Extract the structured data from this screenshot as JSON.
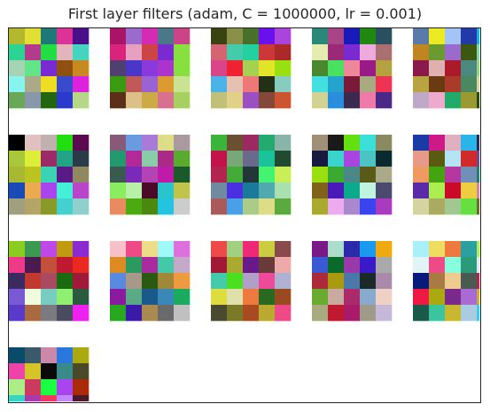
{
  "title": "First layer filters (adam, C = 1000000, lr = 0.001)",
  "chart_data": {
    "type": "heatmap",
    "title": "First layer filters (adam, C = 1000000, lr = 0.001)",
    "grid": {
      "rows": 4,
      "cols": 5,
      "filters": 16
    },
    "filter_size": 5,
    "axes_visible": false,
    "filters": [
      [
        "#b4b82e",
        "#e0e034",
        "#1e7878",
        "#dd3399",
        "#4a108a",
        "#2cd494",
        "#b43a8e",
        "#22dd44",
        "#e2b4bc",
        "#44d4c0",
        "#a4d4b4",
        "#62e488",
        "#7a2ad2",
        "#905010",
        "#c88a20",
        "#88f4f0",
        "#aaaa88",
        "#eedd22",
        "#3a4acc",
        "#dd22dd",
        "#68a858",
        "#8898aa",
        "#226610",
        "#2a3acc",
        "#b4d888"
      ],
      [
        "#aa1466",
        "#9a6acc",
        "#d42ab4",
        "#4a7888",
        "#cc4488",
        "#d8247a",
        "#e8a0c0",
        "#cc4444",
        "#7a2ad0",
        "#88e040",
        "#504070",
        "#4a36c8",
        "#8a3adc",
        "#aa34cc",
        "#88e040",
        "#3a9a10",
        "#c05a58",
        "#9a62d4",
        "#dd9a30",
        "#c8e490",
        "#5c3018",
        "#dcc088",
        "#ccaa44",
        "#d87090",
        "#a8d060"
      ],
      [
        "#3a4410",
        "#8a9048",
        "#48702a",
        "#6a10ee",
        "#aa44dd",
        "#d46472",
        "#44ccaa",
        "#22d0a0",
        "#cc3838",
        "#aa2a2a",
        "#da4488",
        "#ee2233",
        "#a6d050",
        "#e2e42a",
        "#9ae010",
        "#4ab4e8",
        "#e6c0b0",
        "#ee7878",
        "#223018",
        "#88ccc0",
        "#c0c078",
        "#e0d088",
        "#9a50c0",
        "#844838",
        "#cc5430"
      ],
      [
        "#2a8878",
        "#aa4488",
        "#1a1ab8",
        "#1e8810",
        "#2a5060",
        "#e4ecb0",
        "#9a2a78",
        "#7a2ad2",
        "#eeaadd",
        "#aa7070",
        "#4a8830",
        "#4ae060",
        "#ee8899",
        "#9a1a88",
        "#b4a240",
        "#44e0e0",
        "#22a4cc",
        "#7a1a38",
        "#aaaa80",
        "#ee3355",
        "#d2d292",
        "#2a8edc",
        "#3a2a50",
        "#ee7aaa",
        "#4a2888"
      ],
      [
        "#5a7aaa",
        "#ecea22",
        "#a4c4f8",
        "#223aa8",
        "#22aadd",
        "#c08420",
        "#6a9a30",
        "#9a6acc",
        "#3a5810",
        "#88d0aa",
        "#8a1a4a",
        "#e0b0b0",
        "#aa1a2a",
        "#4a8880",
        "#9ad088",
        "#b8a440",
        "#6a3a10",
        "#aa3a2a",
        "#4a8860",
        "#d4d0a8",
        "#c0a8c8",
        "#eeaacc",
        "#22aa6a",
        "#9a9a30",
        "#2a4810"
      ],
      [
        "#000000",
        "#e0c0c0",
        "#c0b0b0",
        "#22dd10",
        "#5c0a50",
        "#a8c83a",
        "#ddee38",
        "#9a2a68",
        "#22a488",
        "#2a3a48",
        "#a8b830",
        "#bcc420",
        "#3ad4b4",
        "#5a1a88",
        "#908860",
        "#1a4ab8",
        "#ecaa50",
        "#aa44ee",
        "#44f0d8",
        "#bb44cc",
        "#a0a080",
        "#b4a468",
        "#8a9a28",
        "#44d0ce",
        "#90d0cc"
      ],
      [
        "#885a78",
        "#6a9ae0",
        "#aa7ad8",
        "#dddd88",
        "#aa9aa0",
        "#229a70",
        "#b22a98",
        "#88ccaa",
        "#aa2a88",
        "#5aaa30",
        "#3a5a50",
        "#7a2ab8",
        "#b444b4",
        "#c01aa8",
        "#1a5a28",
        "#88ee60",
        "#b8f0a8",
        "#4a0a28",
        "#2ac4cc",
        "#c0c44a",
        "#ea8a60",
        "#4aaa10",
        "#4a8810",
        "#22c4e0",
        "#cccccc"
      ],
      [
        "#3ab43a",
        "#6a5030",
        "#9a2a60",
        "#22aa70",
        "#8ab4aa",
        "#c0144a",
        "#78a878",
        "#6a6a8a",
        "#1ac498",
        "#224a30",
        "#b42450",
        "#44aa38",
        "#223838",
        "#44f470",
        "#c8ee58",
        "#708aa0",
        "#4a30e0",
        "#1a7a9a",
        "#50a8b0",
        "#a8e0b0",
        "#aa5a58",
        "#4aa0e8",
        "#aacc88",
        "#dddd88",
        "#5aaa40"
      ],
      [
        "#a09078",
        "#1a1a1a",
        "#64e010",
        "#3ae0d8",
        "#8a8a60",
        "#1a1a40",
        "#3ad4cc",
        "#aa44e0",
        "#4ac4c4",
        "#0a2a30",
        "#9ae010",
        "#3aaa30",
        "#4a8888",
        "#5a5a18",
        "#aaaa88",
        "#80621a",
        "#4a1ab8",
        "#0aaa8a",
        "#c0f4e0",
        "#4a4a70",
        "#aaaa30",
        "#eeaaee",
        "#aa88d0",
        "#3a44ee",
        "#aa3ac0"
      ],
      [
        "#1a3aa8",
        "#cc1a88",
        "#e0b0c0",
        "#2ab4e8",
        "#2a2a50",
        "#e89a88",
        "#5a5a10",
        "#b4e4f4",
        "#d02a2a",
        "#6a4a88",
        "#ee9a60",
        "#44a410",
        "#b438a0",
        "#7090b8",
        "#2a7a70",
        "#5a2aaa",
        "#aaee50",
        "#ca0a28",
        "#eecc44",
        "#c88aa0",
        "#d4d4a0",
        "#aaaa60",
        "#a0c890",
        "#66e040",
        "#6a6a38"
      ],
      [
        "#8acc20",
        "#3a9a50",
        "#c048e8",
        "#c09a10",
        "#8a2ad0",
        "#ee3a88",
        "#4a1a50",
        "#c2503a",
        "#c01a30",
        "#ea2a20",
        "#3a2a60",
        "#c03a30",
        "#aa4a60",
        "#1a6a10",
        "#a01a38",
        "#7a5ad4",
        "#f0fce0",
        "#78ccc0",
        "#90ee70",
        "#2a5a40",
        "#5a3ac8",
        "#aa6a40",
        "#7a7a80",
        "#4a4a60",
        "#ee22ee"
      ],
      [
        "#f8c0c8",
        "#ee4a88",
        "#eedd88",
        "#a0f8f8",
        "#dd70dd",
        "#dd8a20",
        "#2a9a60",
        "#aa2aa0",
        "#44c8a8",
        "#c4a8c8",
        "#5a8ae0",
        "#a89888",
        "#2a5a10",
        "#a08838",
        "#ee9a40",
        "#8a1aa0",
        "#5aaa88",
        "#1a5a8a",
        "#3a88b8",
        "#1aaa60",
        "#28a820",
        "#3a1aa8",
        "#aa8a50",
        "#6a6a6a",
        "#c0c0c0"
      ],
      [
        "#ee4a4a",
        "#a0d080",
        "#ee2a78",
        "#cccc40",
        "#884a4a",
        "#a01a38",
        "#aaaa30",
        "#6a1a88",
        "#6a3a3a",
        "#eeaaaa",
        "#44ccaa",
        "#4ae020",
        "#b0a0c8",
        "#ee4a9a",
        "#b0b0d0",
        "#dddd40",
        "#e0e0aa",
        "#ee7a40",
        "#2a6a20",
        "#9a4a20",
        "#4a4a30",
        "#7a7a28",
        "#aa4a20",
        "#bbaa30",
        "#ee4a88"
      ],
      [
        "#7a1a88",
        "#aaddcc",
        "#2a2aaa",
        "#1a9aee",
        "#eeaa10",
        "#3a5ad4",
        "#0a6a2a",
        "#9a3aaa",
        "#3a1ac8",
        "#aaaaaa",
        "#aa2a3a",
        "#aa9a10",
        "#4a78aa",
        "#1a2a2a",
        "#aa8aaa",
        "#6aaa30",
        "#c8aaa0",
        "#aa2a6a",
        "#88aacc",
        "#eed0c4",
        "#aaaa80",
        "#c01a30",
        "#aa1a6a",
        "#a09a8a",
        "#c8b8d8"
      ],
      [
        "#aaf0f8",
        "#eedd60",
        "#ee7a40",
        "#2aa0a0",
        "#aaee60",
        "#e0f4f4",
        "#ee4a88",
        "#88ffdd",
        "#2a9a7a",
        "#e2e8f0",
        "#0a1a7a",
        "#aa7a44",
        "#eecc90",
        "#4a5a50",
        "#aa2a4a",
        "#ee1a44",
        "#aaaa10",
        "#7a2a8a",
        "#aa6ad4",
        "#c8aa44",
        "#1a5a4a",
        "#3ac4a0",
        "#c8b830",
        "#aacce0",
        "#4ac4e8"
      ],
      [
        "#0a4a6a",
        "#3a5a6a",
        "#cc88a8",
        "#2a78dd",
        "#aaaa10",
        "#ee44aa",
        "#d4c428",
        "#0a0a0a",
        "#3a8a8a",
        "#4a4a2a",
        "#aaee88",
        "#cc3a60",
        "#1aff44",
        "#aa44ee",
        "#aa2a0a",
        "#3ad4c4",
        "#aa3aaa",
        "#ee3a60",
        "#c088ff",
        "#4a1a2a",
        "#9a5a10",
        "#ee10c4",
        "#d4d8b8",
        "#bb3a7a",
        "#88c0ee"
      ]
    ]
  }
}
